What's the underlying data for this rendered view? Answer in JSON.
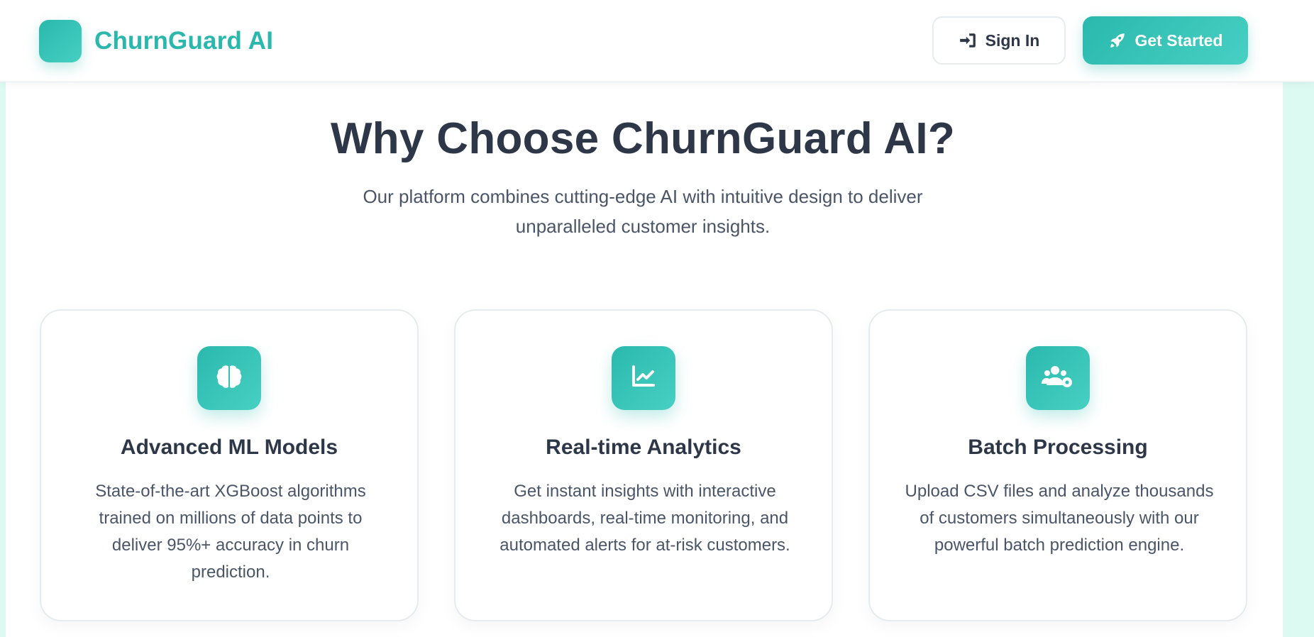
{
  "brand": {
    "name": "ChurnGuard AI",
    "logo_icon": "brand-logo-square",
    "color": "#2ab7ac"
  },
  "nav": {
    "sign_in_label": "Sign In",
    "sign_in_icon": "sign-in-icon",
    "get_started_label": "Get Started",
    "get_started_icon": "rocket-icon"
  },
  "section": {
    "title": "Why Choose ChurnGuard AI?",
    "subtitle": "Our platform combines cutting-edge AI with intuitive design to deliver unparalleled customer insights."
  },
  "features": [
    {
      "icon": "brain-icon",
      "title": "Advanced ML Models",
      "description": "State-of-the-art XGBoost algorithms trained on millions of data points to deliver 95%+ accuracy in churn prediction."
    },
    {
      "icon": "chart-line-icon",
      "title": "Real-time Analytics",
      "description": "Get instant insights with interactive dashboards, real-time monitoring, and automated alerts for at-risk customers."
    },
    {
      "icon": "users-cog-icon",
      "title": "Batch Processing",
      "description": "Upload CSV files and analyze thousands of customers simultaneously with our powerful batch prediction engine."
    }
  ],
  "colors": {
    "accent": "#2bb9ad",
    "accent_light": "#47d0c3",
    "text_dark": "#2d3748",
    "text_muted": "#4a5568",
    "border": "#e6ebef",
    "background_tint": "#dcfaf2"
  }
}
